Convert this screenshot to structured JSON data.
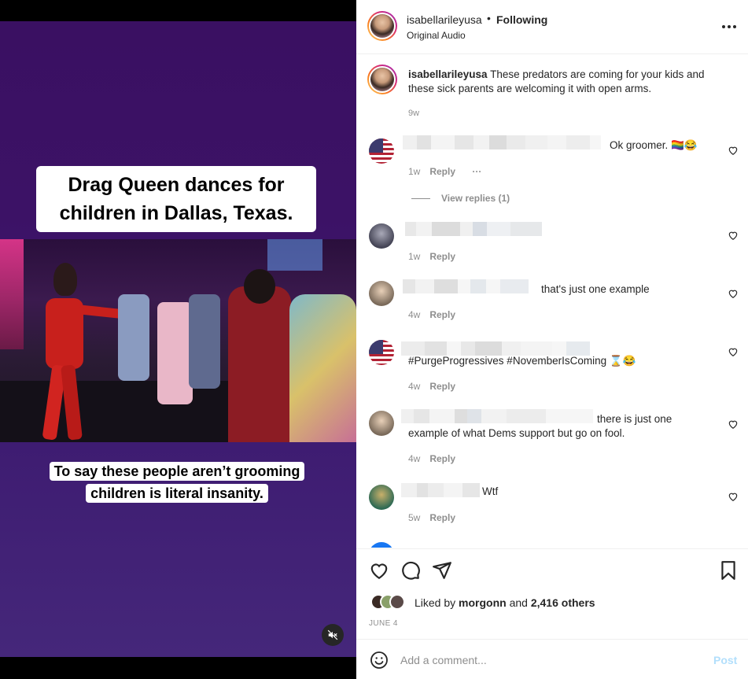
{
  "video": {
    "caption_top": "Drag Queen dances for children in Dallas, Texas.",
    "caption_bottom": "To say these people aren’t grooming children is literal insanity.",
    "mute_icon": "speaker-muted-icon"
  },
  "header": {
    "username": "isabellarileyusa",
    "separator": "•",
    "follow_status": "Following",
    "audio": "Original Audio",
    "more_icon": "more-horizontal-icon"
  },
  "caption": {
    "username": "isabellarileyusa",
    "text": "These predators are coming for your kids and these sick parents are welcoming it with open arms.",
    "time": "9w"
  },
  "comments": [
    {
      "text": "Ok groomer. 🏳️‍🌈😂",
      "time": "1w",
      "reply": "Reply",
      "has_options": true,
      "view_replies": "View replies (1)"
    },
    {
      "text": "",
      "time": "1w",
      "reply": "Reply"
    },
    {
      "text": "that's just one example",
      "time": "4w",
      "reply": "Reply"
    },
    {
      "text": "#PurgeProgressives #NovemberIsComing ⌛😂",
      "time": "4w",
      "reply": "Reply"
    },
    {
      "text_line1": "there is just one",
      "text_line2": "example of what Dems support but go on fool.",
      "time": "4w",
      "reply": "Reply"
    },
    {
      "text": "Wtf",
      "time": "5w",
      "reply": "Reply"
    }
  ],
  "footer": {
    "liked_by": "Liked by",
    "liker": "morgonn",
    "and": "and",
    "others": "2,416 others",
    "date": "JUNE 4",
    "add_comment_placeholder": "Add a comment...",
    "post_label": "Post"
  },
  "colors": {
    "link": "#00376b",
    "post_disabled": "#b2dffc",
    "muted_text": "#8e8e8e"
  }
}
